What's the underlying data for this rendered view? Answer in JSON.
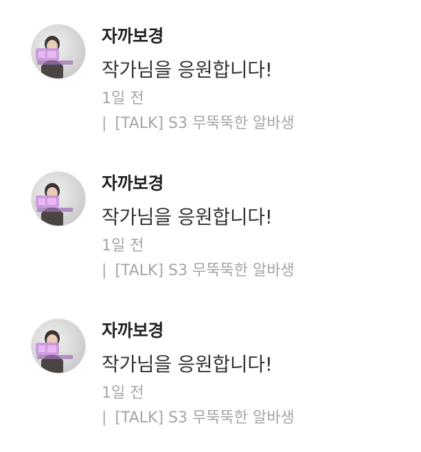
{
  "comments": [
    {
      "author": "자까보경",
      "avatar_icon": "user-avatar-icon",
      "message": "작가님을 응원합니다!",
      "time": "1일 전",
      "separator": "|",
      "episode": "[TALK]  S3 무뚝뚝한 알바생"
    },
    {
      "author": "자까보경",
      "avatar_icon": "user-avatar-icon",
      "message": "작가님을 응원합니다!",
      "time": "1일 전",
      "separator": "|",
      "episode": "[TALK]  S3 무뚝뚝한 알바생"
    },
    {
      "author": "자까보경",
      "avatar_icon": "user-avatar-icon",
      "message": "작가님을 응원합니다!",
      "time": "1일 전",
      "separator": "|",
      "episode": "[TALK]  S3 무뚝뚝한 알바생"
    }
  ],
  "colors": {
    "name": "#222222",
    "message": "#333333",
    "meta": "#a4a4a4",
    "avatar_badge": "#c98fdc"
  }
}
